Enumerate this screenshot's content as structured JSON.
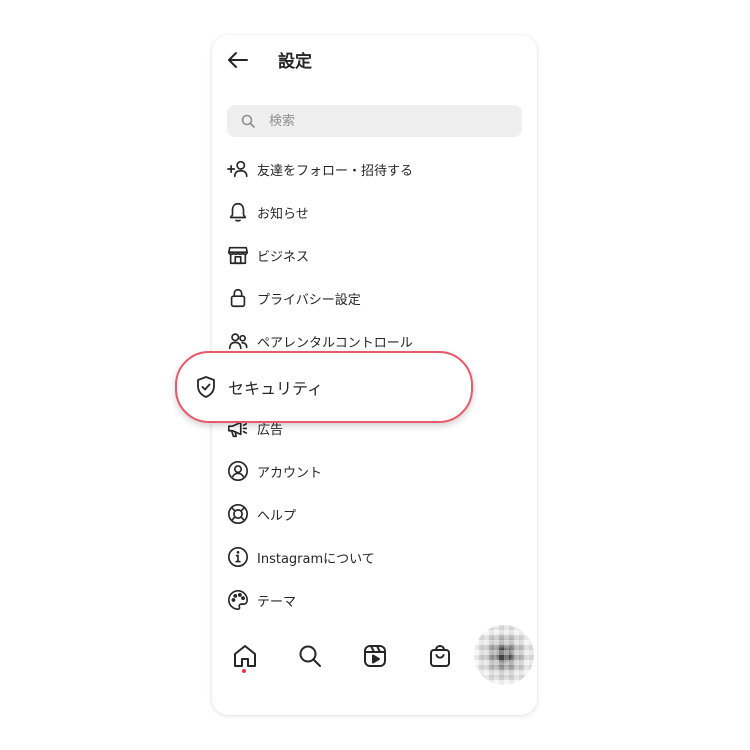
{
  "header": {
    "title": "設定"
  },
  "search": {
    "placeholder": "検索"
  },
  "menu": [
    {
      "label": "友達をフォロー・招待する",
      "icon": "add-person-icon"
    },
    {
      "label": "お知らせ",
      "icon": "bell-icon"
    },
    {
      "label": "ビジネス",
      "icon": "shop-icon"
    },
    {
      "label": "プライバシー設定",
      "icon": "lock-icon"
    },
    {
      "label": "ペアレンタルコントロール",
      "icon": "people-icon"
    },
    {
      "label": "セキュリティ",
      "icon": "shield-check-icon",
      "highlighted": true
    },
    {
      "label": "広告",
      "icon": "megaphone-icon"
    },
    {
      "label": "アカウント",
      "icon": "account-circle-icon"
    },
    {
      "label": "ヘルプ",
      "icon": "lifebuoy-icon"
    },
    {
      "label": "Instagramについて",
      "icon": "info-icon"
    },
    {
      "label": "テーマ",
      "icon": "palette-icon"
    }
  ],
  "tabbar": {
    "tabs": [
      {
        "name": "home",
        "icon": "home-icon",
        "active": true
      },
      {
        "name": "search",
        "icon": "search-icon"
      },
      {
        "name": "reels",
        "icon": "reels-icon"
      },
      {
        "name": "shop",
        "icon": "shopping-bag-icon"
      },
      {
        "name": "profile",
        "icon": "avatar"
      }
    ]
  },
  "colors": {
    "highlight_border": "#e8596a",
    "text": "#262626",
    "placeholder": "#8e8e8e",
    "search_bg": "#efefef",
    "notification_dot": "#ff3040"
  }
}
